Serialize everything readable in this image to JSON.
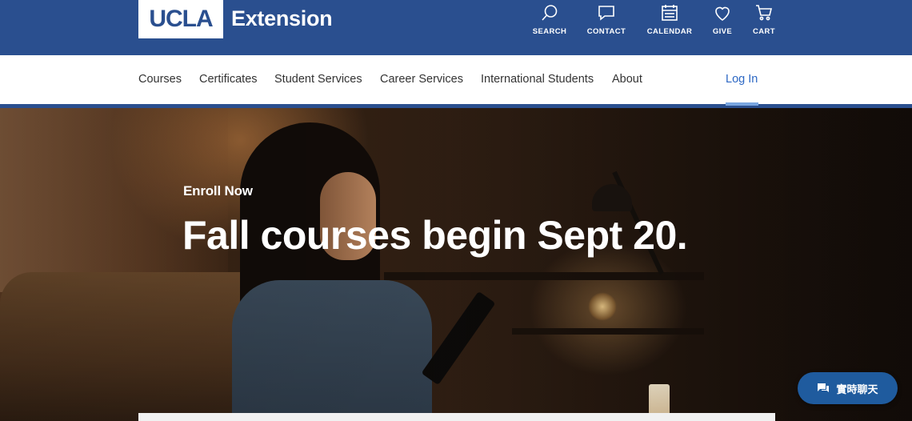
{
  "brand": {
    "logo_text": "UCLA",
    "product": "Extension",
    "primary_color": "#2a4f8f",
    "link_color": "#2d68c4"
  },
  "utility": [
    {
      "label": "SEARCH",
      "icon": "search-icon"
    },
    {
      "label": "CONTACT",
      "icon": "chat-bubble-icon"
    },
    {
      "label": "CALENDAR",
      "icon": "calendar-icon"
    },
    {
      "label": "GIVE",
      "icon": "heart-icon"
    },
    {
      "label": "CART",
      "icon": "cart-icon"
    }
  ],
  "nav": {
    "items": [
      "Courses",
      "Certificates",
      "Student Services",
      "Career Services",
      "International Students",
      "About"
    ],
    "login": "Log In"
  },
  "hero": {
    "eyebrow": "Enroll Now",
    "headline": "Fall courses begin Sept 20."
  },
  "chat": {
    "label": "實時聊天",
    "icon": "chat-icon",
    "color": "#1f5b9e"
  }
}
